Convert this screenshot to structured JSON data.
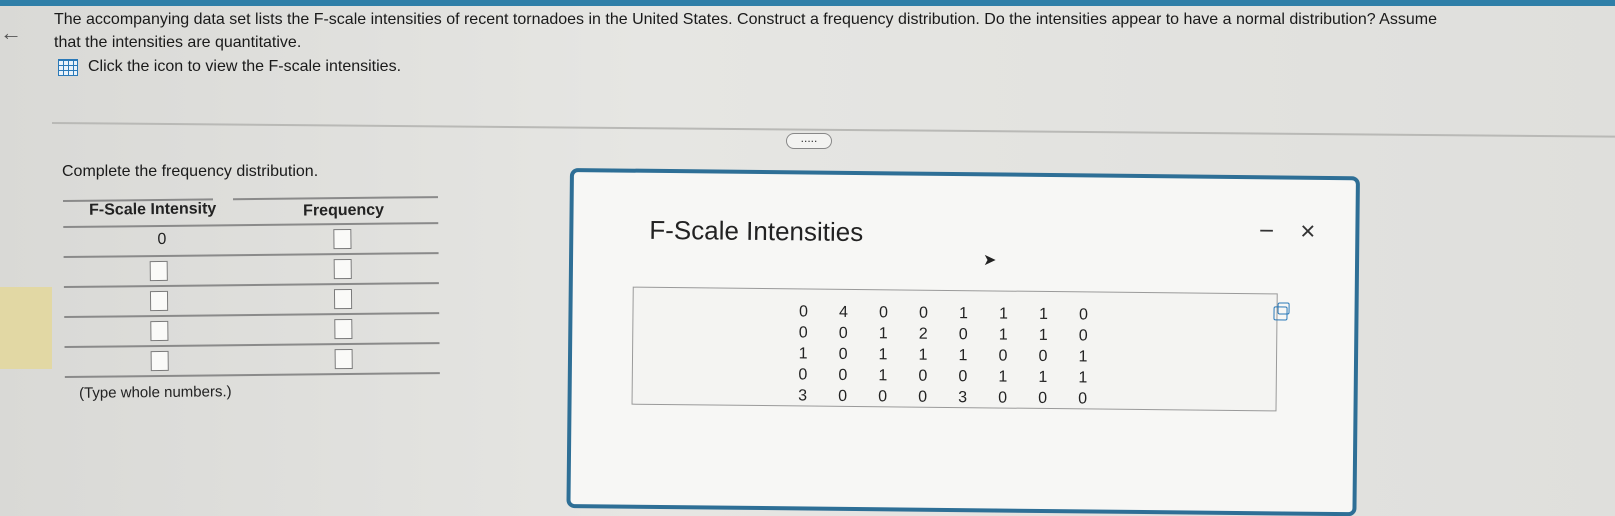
{
  "question": {
    "line1": "The accompanying data set lists the F-scale intensities of recent tornadoes in the United States. Construct a frequency distribution. Do the intensities appear to have a normal distribution? Assume",
    "line2": "that the intensities are quantitative."
  },
  "data_link": {
    "label": "Click the icon to view the F-scale intensities.",
    "icon": "grid-table-icon"
  },
  "more_button": {
    "label": "....."
  },
  "instruction": "Complete the frequency distribution.",
  "freq_table": {
    "col_intensity": "F-Scale Intensity",
    "col_frequency": "Frequency",
    "first_row_label": "0",
    "note": "(Type whole numbers.)"
  },
  "popup": {
    "title": "F-Scale Intensities",
    "minimize": "−",
    "close": "×",
    "columns": [
      [
        "0",
        "0",
        "1",
        "0",
        "3"
      ],
      [
        "4",
        "0",
        "0",
        "0",
        "0"
      ],
      [
        "0",
        "1",
        "1",
        "1",
        "0"
      ],
      [
        "0",
        "2",
        "1",
        "0",
        "0"
      ],
      [
        "1",
        "0",
        "1",
        "0",
        "3"
      ],
      [
        "1",
        "1",
        "0",
        "1",
        "0"
      ],
      [
        "1",
        "1",
        "0",
        "1",
        "0"
      ],
      [
        "0",
        "0",
        "1",
        "1",
        "0"
      ]
    ]
  }
}
